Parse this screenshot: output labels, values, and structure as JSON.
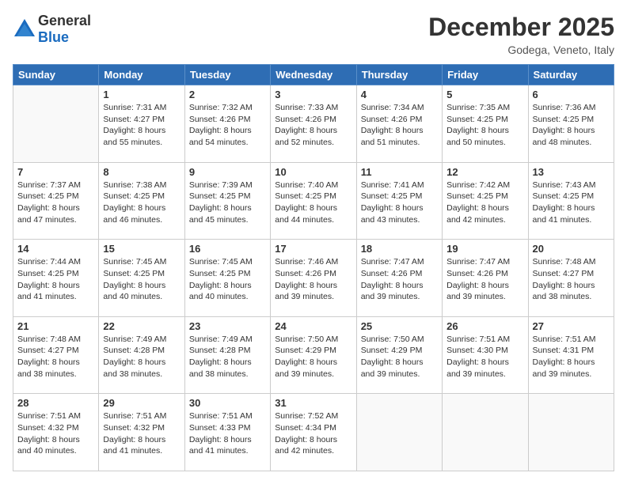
{
  "header": {
    "logo": {
      "line1": "General",
      "line2": "Blue"
    },
    "title": "December 2025",
    "location": "Godega, Veneto, Italy"
  },
  "days_of_week": [
    "Sunday",
    "Monday",
    "Tuesday",
    "Wednesday",
    "Thursday",
    "Friday",
    "Saturday"
  ],
  "weeks": [
    [
      {
        "day": "",
        "sunrise": "",
        "sunset": "",
        "daylight": ""
      },
      {
        "day": "1",
        "sunrise": "Sunrise: 7:31 AM",
        "sunset": "Sunset: 4:27 PM",
        "daylight": "Daylight: 8 hours and 55 minutes."
      },
      {
        "day": "2",
        "sunrise": "Sunrise: 7:32 AM",
        "sunset": "Sunset: 4:26 PM",
        "daylight": "Daylight: 8 hours and 54 minutes."
      },
      {
        "day": "3",
        "sunrise": "Sunrise: 7:33 AM",
        "sunset": "Sunset: 4:26 PM",
        "daylight": "Daylight: 8 hours and 52 minutes."
      },
      {
        "day": "4",
        "sunrise": "Sunrise: 7:34 AM",
        "sunset": "Sunset: 4:26 PM",
        "daylight": "Daylight: 8 hours and 51 minutes."
      },
      {
        "day": "5",
        "sunrise": "Sunrise: 7:35 AM",
        "sunset": "Sunset: 4:25 PM",
        "daylight": "Daylight: 8 hours and 50 minutes."
      },
      {
        "day": "6",
        "sunrise": "Sunrise: 7:36 AM",
        "sunset": "Sunset: 4:25 PM",
        "daylight": "Daylight: 8 hours and 48 minutes."
      }
    ],
    [
      {
        "day": "7",
        "sunrise": "Sunrise: 7:37 AM",
        "sunset": "Sunset: 4:25 PM",
        "daylight": "Daylight: 8 hours and 47 minutes."
      },
      {
        "day": "8",
        "sunrise": "Sunrise: 7:38 AM",
        "sunset": "Sunset: 4:25 PM",
        "daylight": "Daylight: 8 hours and 46 minutes."
      },
      {
        "day": "9",
        "sunrise": "Sunrise: 7:39 AM",
        "sunset": "Sunset: 4:25 PM",
        "daylight": "Daylight: 8 hours and 45 minutes."
      },
      {
        "day": "10",
        "sunrise": "Sunrise: 7:40 AM",
        "sunset": "Sunset: 4:25 PM",
        "daylight": "Daylight: 8 hours and 44 minutes."
      },
      {
        "day": "11",
        "sunrise": "Sunrise: 7:41 AM",
        "sunset": "Sunset: 4:25 PM",
        "daylight": "Daylight: 8 hours and 43 minutes."
      },
      {
        "day": "12",
        "sunrise": "Sunrise: 7:42 AM",
        "sunset": "Sunset: 4:25 PM",
        "daylight": "Daylight: 8 hours and 42 minutes."
      },
      {
        "day": "13",
        "sunrise": "Sunrise: 7:43 AM",
        "sunset": "Sunset: 4:25 PM",
        "daylight": "Daylight: 8 hours and 41 minutes."
      }
    ],
    [
      {
        "day": "14",
        "sunrise": "Sunrise: 7:44 AM",
        "sunset": "Sunset: 4:25 PM",
        "daylight": "Daylight: 8 hours and 41 minutes."
      },
      {
        "day": "15",
        "sunrise": "Sunrise: 7:45 AM",
        "sunset": "Sunset: 4:25 PM",
        "daylight": "Daylight: 8 hours and 40 minutes."
      },
      {
        "day": "16",
        "sunrise": "Sunrise: 7:45 AM",
        "sunset": "Sunset: 4:25 PM",
        "daylight": "Daylight: 8 hours and 40 minutes."
      },
      {
        "day": "17",
        "sunrise": "Sunrise: 7:46 AM",
        "sunset": "Sunset: 4:26 PM",
        "daylight": "Daylight: 8 hours and 39 minutes."
      },
      {
        "day": "18",
        "sunrise": "Sunrise: 7:47 AM",
        "sunset": "Sunset: 4:26 PM",
        "daylight": "Daylight: 8 hours and 39 minutes."
      },
      {
        "day": "19",
        "sunrise": "Sunrise: 7:47 AM",
        "sunset": "Sunset: 4:26 PM",
        "daylight": "Daylight: 8 hours and 39 minutes."
      },
      {
        "day": "20",
        "sunrise": "Sunrise: 7:48 AM",
        "sunset": "Sunset: 4:27 PM",
        "daylight": "Daylight: 8 hours and 38 minutes."
      }
    ],
    [
      {
        "day": "21",
        "sunrise": "Sunrise: 7:48 AM",
        "sunset": "Sunset: 4:27 PM",
        "daylight": "Daylight: 8 hours and 38 minutes."
      },
      {
        "day": "22",
        "sunrise": "Sunrise: 7:49 AM",
        "sunset": "Sunset: 4:28 PM",
        "daylight": "Daylight: 8 hours and 38 minutes."
      },
      {
        "day": "23",
        "sunrise": "Sunrise: 7:49 AM",
        "sunset": "Sunset: 4:28 PM",
        "daylight": "Daylight: 8 hours and 38 minutes."
      },
      {
        "day": "24",
        "sunrise": "Sunrise: 7:50 AM",
        "sunset": "Sunset: 4:29 PM",
        "daylight": "Daylight: 8 hours and 39 minutes."
      },
      {
        "day": "25",
        "sunrise": "Sunrise: 7:50 AM",
        "sunset": "Sunset: 4:29 PM",
        "daylight": "Daylight: 8 hours and 39 minutes."
      },
      {
        "day": "26",
        "sunrise": "Sunrise: 7:51 AM",
        "sunset": "Sunset: 4:30 PM",
        "daylight": "Daylight: 8 hours and 39 minutes."
      },
      {
        "day": "27",
        "sunrise": "Sunrise: 7:51 AM",
        "sunset": "Sunset: 4:31 PM",
        "daylight": "Daylight: 8 hours and 39 minutes."
      }
    ],
    [
      {
        "day": "28",
        "sunrise": "Sunrise: 7:51 AM",
        "sunset": "Sunset: 4:32 PM",
        "daylight": "Daylight: 8 hours and 40 minutes."
      },
      {
        "day": "29",
        "sunrise": "Sunrise: 7:51 AM",
        "sunset": "Sunset: 4:32 PM",
        "daylight": "Daylight: 8 hours and 41 minutes."
      },
      {
        "day": "30",
        "sunrise": "Sunrise: 7:51 AM",
        "sunset": "Sunset: 4:33 PM",
        "daylight": "Daylight: 8 hours and 41 minutes."
      },
      {
        "day": "31",
        "sunrise": "Sunrise: 7:52 AM",
        "sunset": "Sunset: 4:34 PM",
        "daylight": "Daylight: 8 hours and 42 minutes."
      },
      {
        "day": "",
        "sunrise": "",
        "sunset": "",
        "daylight": ""
      },
      {
        "day": "",
        "sunrise": "",
        "sunset": "",
        "daylight": ""
      },
      {
        "day": "",
        "sunrise": "",
        "sunset": "",
        "daylight": ""
      }
    ]
  ]
}
